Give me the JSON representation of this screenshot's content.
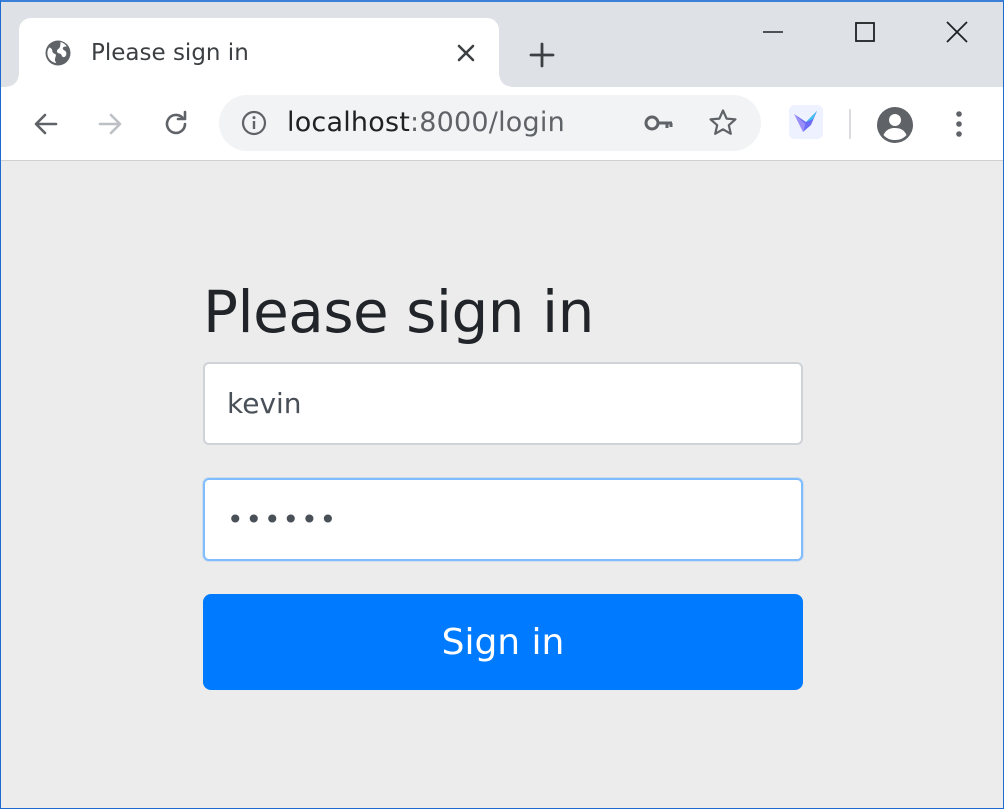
{
  "browser": {
    "tab": {
      "title": "Please sign in",
      "favicon": "globe-icon",
      "close_icon": "close-icon"
    },
    "new_tab_icon": "plus-icon",
    "window_controls": {
      "minimize": "minimize-icon",
      "maximize": "maximize-icon",
      "close": "close-icon"
    },
    "toolbar": {
      "back_icon": "back-arrow-icon",
      "forward_icon": "forward-arrow-icon",
      "reload_icon": "reload-icon",
      "url_host": "localhost",
      "url_rest": ":8000/login",
      "info_icon": "info-icon",
      "key_icon": "key-icon",
      "star_icon": "star-icon",
      "extension_icon": "bird-extension-icon",
      "profile_icon": "profile-icon",
      "menu_icon": "kebab-menu-icon"
    }
  },
  "login": {
    "heading": "Please sign in",
    "username_value": "kevin",
    "password_value": "••••••",
    "submit_label": "Sign in"
  },
  "colors": {
    "accent": "#007bff",
    "page_bg": "#ececec",
    "focus_border": "#80bdff"
  }
}
